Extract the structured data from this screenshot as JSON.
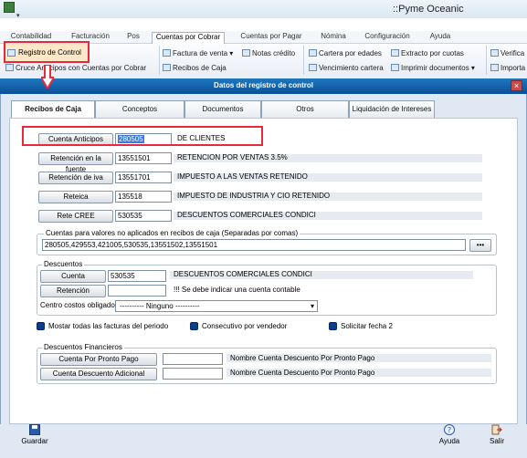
{
  "app": {
    "title": "::Pyme Oceanic",
    "quick_dropdown": "▾"
  },
  "menu": [
    "Contabilidad",
    "Facturación",
    "Pos",
    "Cuentas por Cobrar",
    "Cuentas por Pagar",
    "Nómina",
    "Configuración",
    "Ayuda"
  ],
  "ribbon": {
    "registro_control": "Registro de Control",
    "cruce_anticipos": "Cruce Anticipos con Cuentas por Cobrar",
    "factura_venta": "Factura de venta",
    "notas_credito": "Notas crédito",
    "recibos_caja": "Recibos de Caja",
    "cartera_edades": "Cartera por edades",
    "extracto_cuotas": "Extracto por cuotas",
    "vencimiento_cartera": "Vencimiento cartera",
    "imprimir_documentos": "Imprimir documentos",
    "verifica": "Verifica",
    "importa": "Importa"
  },
  "dialog": {
    "title": "Datos del registro de control",
    "close": "×"
  },
  "tabs": [
    "Recibos de Caja",
    "Conceptos",
    "Documentos Contables",
    "Otros",
    "Liquidación de Intereses"
  ],
  "accounts": [
    {
      "button": "Cuenta Anticipos",
      "code": "280505",
      "desc": "DE CLIENTES"
    },
    {
      "button": "Retención en la fuente",
      "code": "13551501",
      "desc": "RETENCION POR VENTAS 3.5%"
    },
    {
      "button": "Retención de iva",
      "code": "13551701",
      "desc": "IMPUESTO A LAS VENTAS RETENIDO"
    },
    {
      "button": "Reteica",
      "code": "135518",
      "desc": "IMPUESTO DE INDUSTRIA Y  CIO RETENIDO"
    },
    {
      "button": "Rete CREE",
      "code": "530535",
      "desc": "DESCUENTOS COMERCIALES CONDICI"
    }
  ],
  "cuentas_no_aplicadas": {
    "label": "Cuentas para valores no aplicados en recibos de caja (Separadas por comas)",
    "value": "280505,429553,421005,530535,13551502,13551501",
    "button": "•••"
  },
  "descuentos": {
    "legend": "Descuentos",
    "cuenta_button": "Cuenta",
    "cuenta_code": "530535",
    "cuenta_desc": "DESCUENTOS COMERCIALES CONDICI",
    "retencion_button": "Retención",
    "retencion_code": "",
    "retencion_desc": "!!! Se debe indicar una cuenta contable",
    "centro_label": "Centro costos obligado",
    "centro_value": "---------- Ninguno ----------"
  },
  "checks": [
    "Mostar todas las facturas del periodo",
    "Consecutivo por vendedor",
    "Solicitar fecha 2"
  ],
  "financieros": {
    "legend": "Descuentos Financieros",
    "pronto_button": "Cuenta Por Pronto Pago",
    "pronto_code": "",
    "pronto_desc": "Nombre Cuenta Descuento Por Pronto Pago",
    "adicional_button": "Cuenta Descuento Adicional",
    "adicional_code": "",
    "adicional_desc": "Nombre Cuenta Descuento Por Pronto Pago"
  },
  "footer": {
    "guardar": "Guardar",
    "ayuda": "Ayuda",
    "salir": "Salir"
  },
  "colors": {
    "title_bar": "#0a4f96",
    "highlight": "#e8283c",
    "dialog_bg": "#dfe8f3",
    "selected": "#3b7be0"
  }
}
